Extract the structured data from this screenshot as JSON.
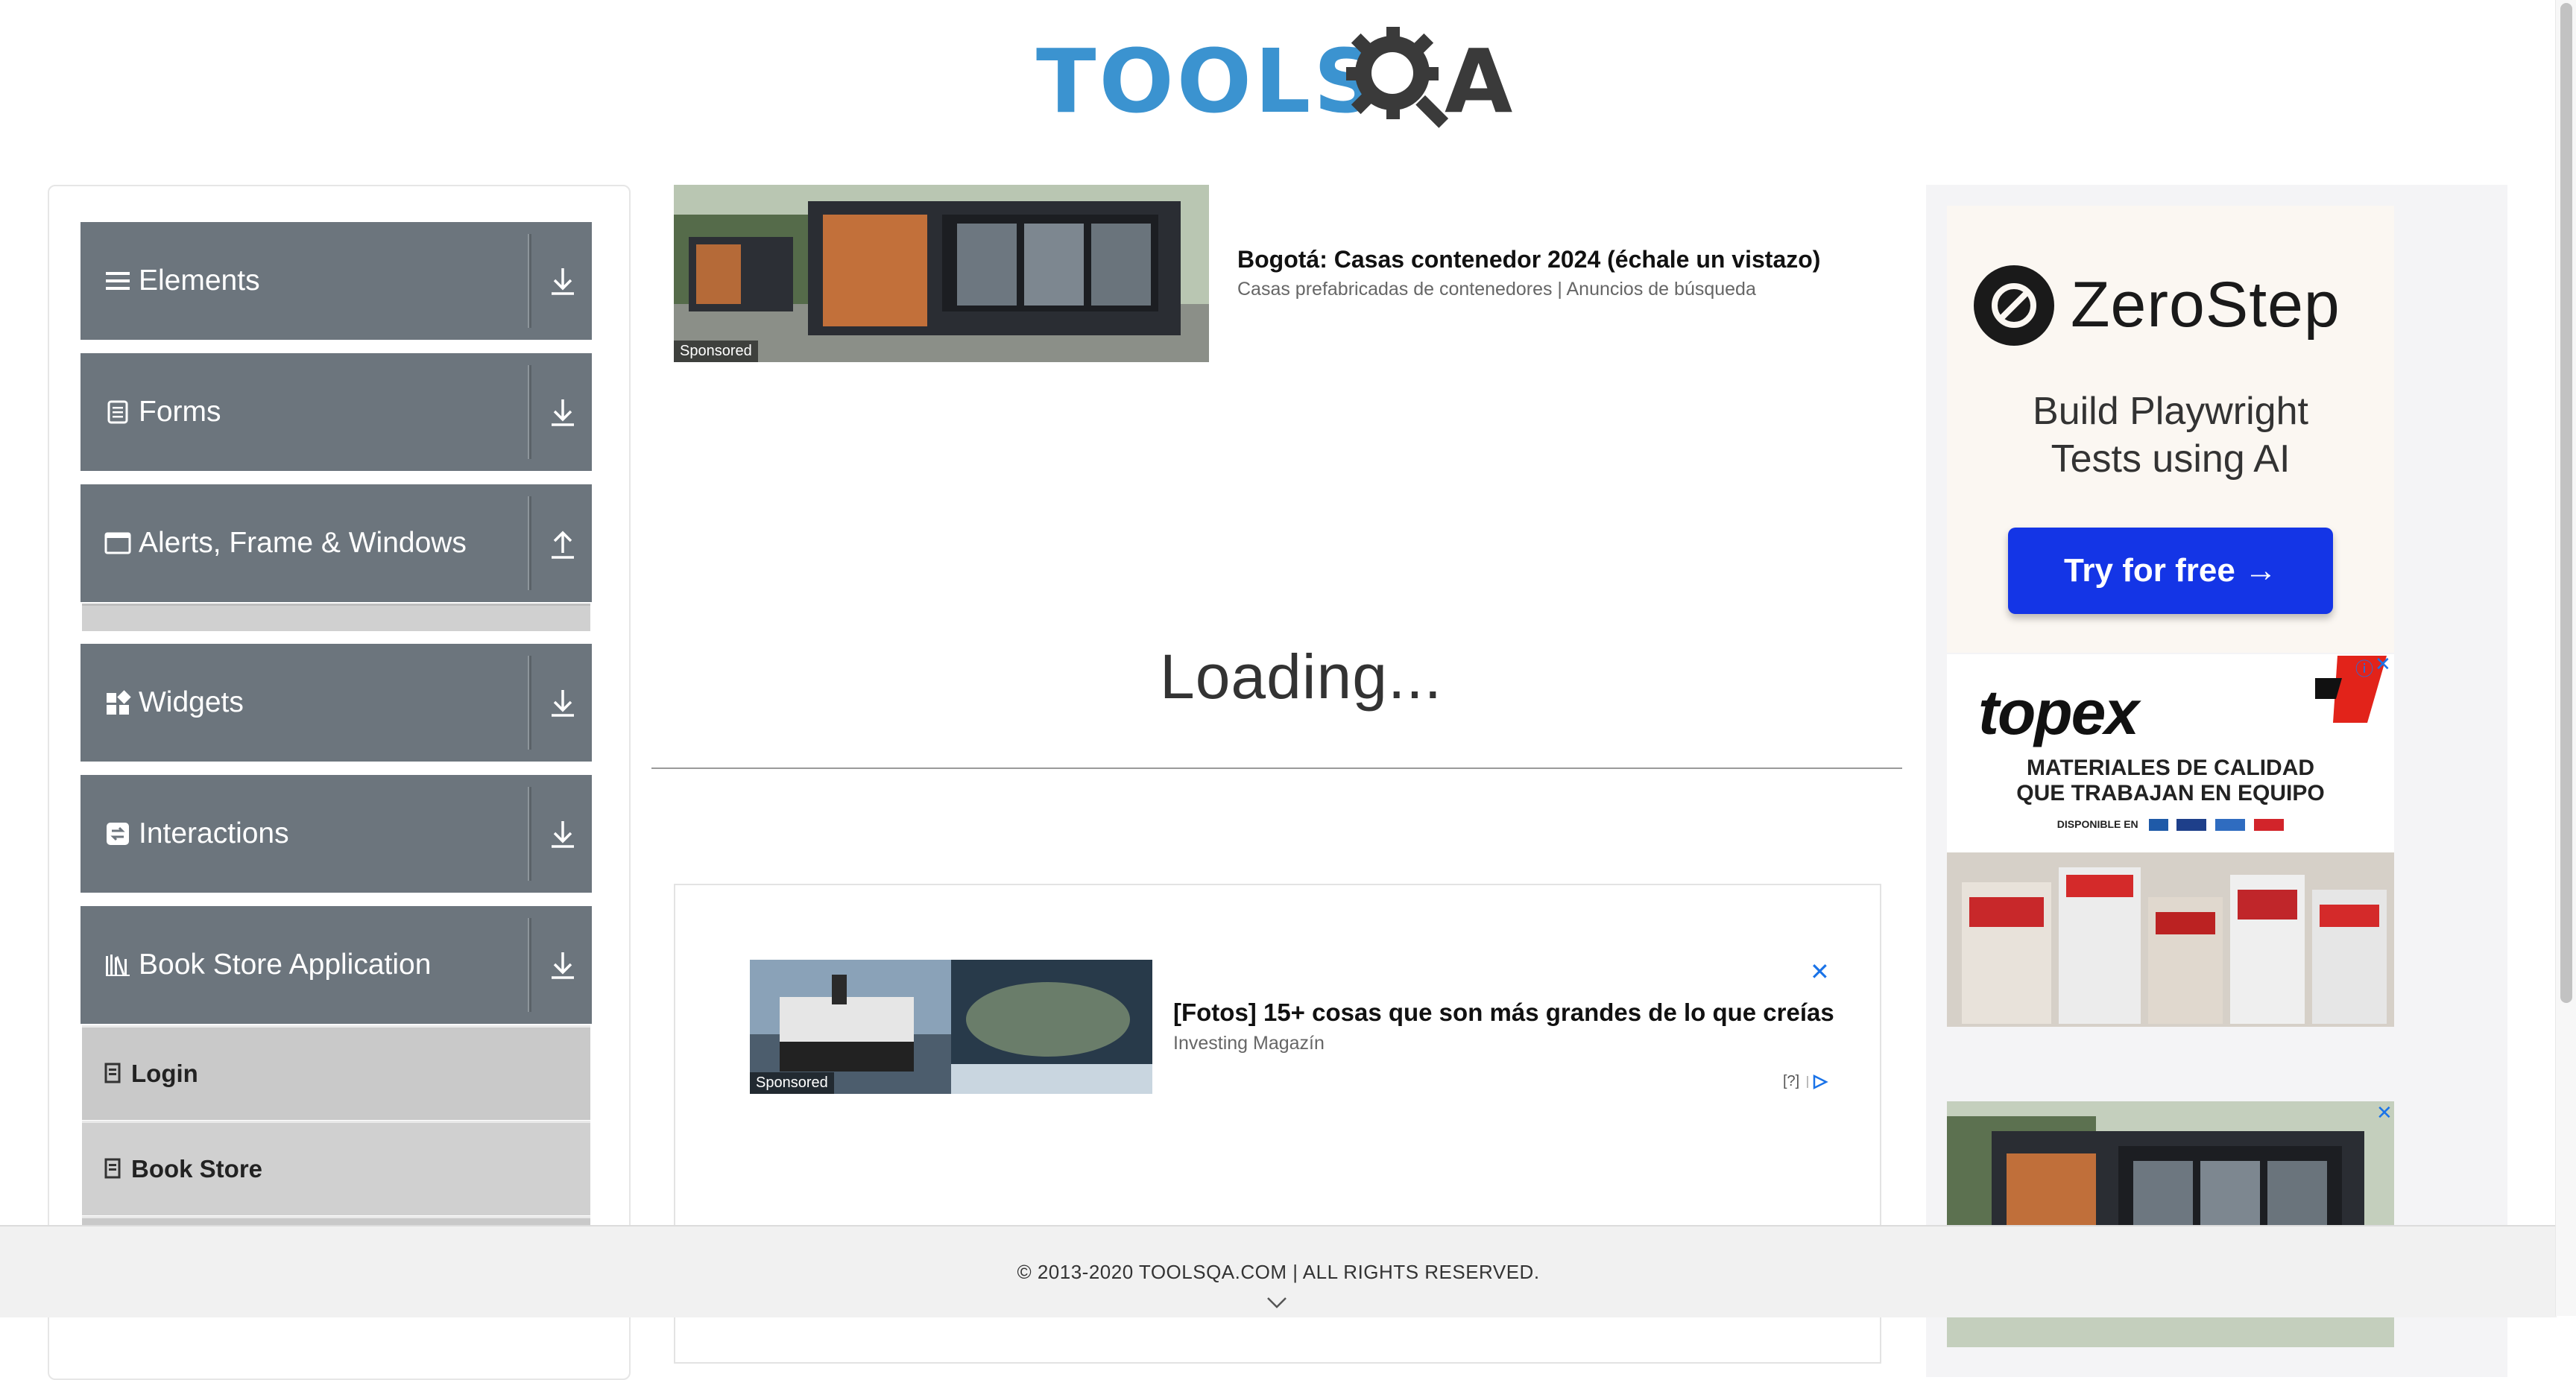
{
  "header": {
    "logo_part1": "TOOLS",
    "logo_part2": "A",
    "logo_text": "TOOLSQA"
  },
  "sidebar": {
    "groups": [
      {
        "label": "Elements",
        "icon": "hamburger-icon",
        "state": "collapsed"
      },
      {
        "label": "Forms",
        "icon": "document-icon",
        "state": "collapsed"
      },
      {
        "label": "Alerts, Frame & Windows",
        "icon": "window-icon",
        "state": "expanded"
      },
      {
        "label": "Widgets",
        "icon": "widgets-icon",
        "state": "collapsed"
      },
      {
        "label": "Interactions",
        "icon": "interactions-icon",
        "state": "collapsed"
      },
      {
        "label": "Book Store Application",
        "icon": "books-icon",
        "state": "expanded"
      }
    ],
    "book_store_items": [
      {
        "label": "Login"
      },
      {
        "label": "Book Store"
      }
    ]
  },
  "ad_top": {
    "title": "Bogotá: Casas contenedor 2024 (échale un vistazo)",
    "subtitle": "Casas prefabricadas de contenedores | Anuncios de búsqueda",
    "sponsored": "Sponsored"
  },
  "main": {
    "loading_text": "Loading..."
  },
  "ad_mid": {
    "title": "[Fotos] 15+ cosas que son más grandes de lo que creías",
    "subtitle": "Investing Magazín",
    "sponsored": "Sponsored",
    "close": "✕",
    "meta": "[?]"
  },
  "right_ads": {
    "zerostep": {
      "brand": "ZeroStep",
      "tagline_line1": "Build Playwright",
      "tagline_line2": "Tests using AI",
      "cta": "Try for free →"
    },
    "topex": {
      "brand": "topex",
      "line1": "MATERIALES DE CALIDAD",
      "line2": "QUE TRABAJAN EN EQUIPO",
      "small": "DISPONIBLE EN",
      "close": "✕",
      "info": "ⓘ"
    },
    "house_close": "✕"
  },
  "footer": {
    "text": "© 2013-2020 TOOLSQA.COM | ALL RIGHTS RESERVED."
  },
  "colors": {
    "sidebar_group": "#6c757d",
    "logo_blue": "#3b93d0",
    "zerostep_button": "#1435e6"
  }
}
